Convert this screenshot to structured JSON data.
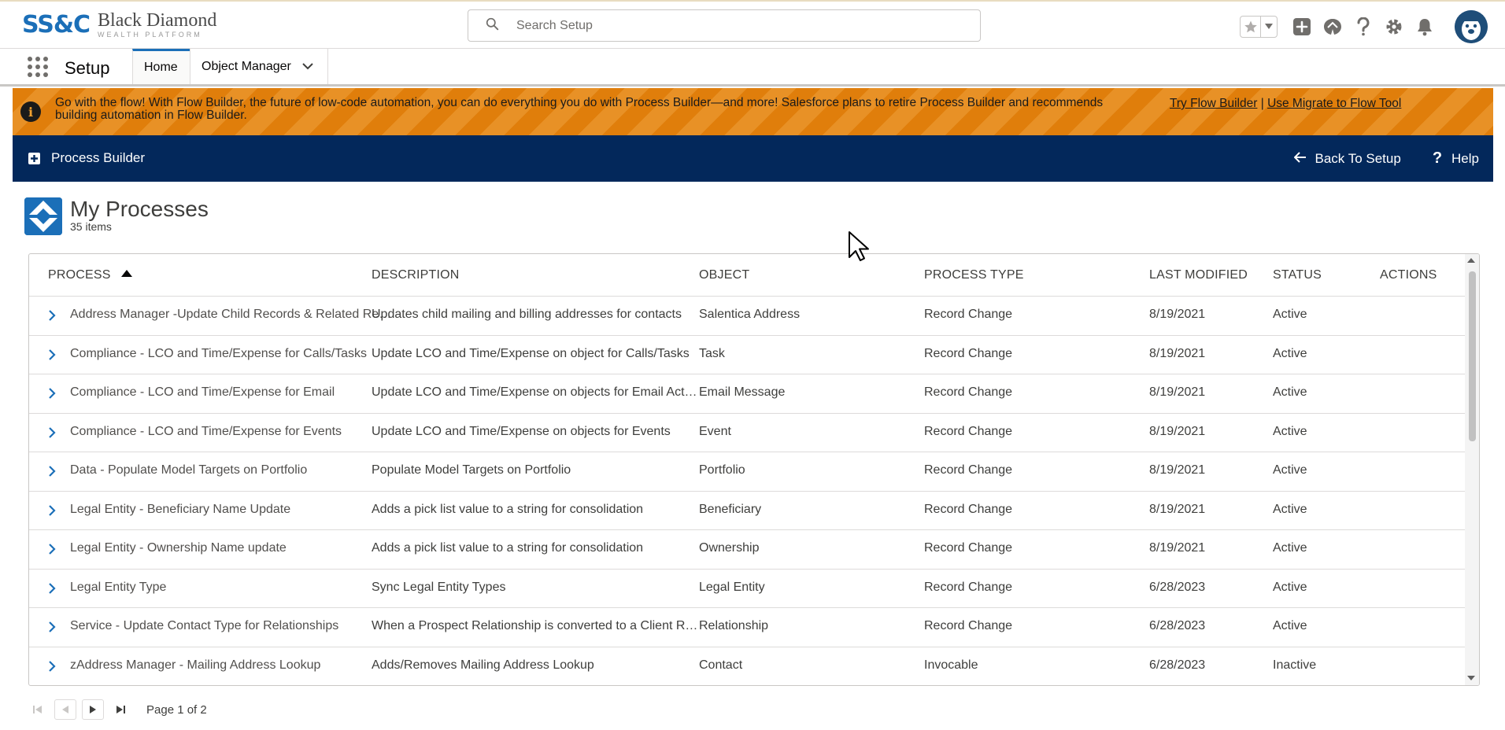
{
  "header": {
    "logo_mark": "SS&C",
    "logo_title": "Black Diamond",
    "logo_subtitle": "WEALTH PLATFORM",
    "search_placeholder": "Search Setup",
    "icons": [
      "star-icon",
      "chevron-down-icon",
      "add-icon",
      "trailhead-icon",
      "help-icon",
      "gear-icon",
      "bell-icon",
      "avatar"
    ]
  },
  "nav": {
    "app_name": "Setup",
    "tabs": [
      {
        "label": "Home",
        "active": true
      },
      {
        "label": "Object Manager",
        "active": false
      }
    ]
  },
  "banner": {
    "text": "Go with the flow! With Flow Builder, the future of low-code automation, you can do everything you do with Process Builder—and more! Salesforce plans to retire Process Builder and recommends building automation in Flow Builder.",
    "link_try": "Try Flow Builder",
    "separator": "|",
    "link_migrate": "Use Migrate to Flow Tool",
    "colors": {
      "stripe_a": "#e07e0b",
      "stripe_b": "#e89126"
    }
  },
  "pb_bar": {
    "title": "Process Builder",
    "back_label": "Back To Setup",
    "help_label": "Help",
    "color": "#03285b"
  },
  "processes": {
    "title": "My Processes",
    "count": "35 items",
    "columns": {
      "process": "PROCESS",
      "description": "DESCRIPTION",
      "object": "OBJECT",
      "type": "PROCESS TYPE",
      "modified": "LAST MODIFIED",
      "status": "STATUS",
      "actions": "ACTIONS"
    },
    "sort": {
      "column": "process",
      "direction": "ascending"
    },
    "rows": [
      {
        "process": "Address Manager -Update Child Records & Related Records",
        "description": "Updates child mailing and billing addresses for contacts",
        "object": "Salentica Address",
        "type": "Record Change",
        "modified": "8/19/2021",
        "status": "Active"
      },
      {
        "process": "Compliance - LCO and Time/Expense for Calls/Tasks",
        "description": "Update LCO and Time/Expense on object for Calls/Tasks",
        "object": "Task",
        "type": "Record Change",
        "modified": "8/19/2021",
        "status": "Active"
      },
      {
        "process": "Compliance - LCO and Time/Expense for Email",
        "description": "Update LCO and Time/Expense on objects for Email Activity",
        "object": "Email Message",
        "type": "Record Change",
        "modified": "8/19/2021",
        "status": "Active"
      },
      {
        "process": "Compliance - LCO and Time/Expense for Events",
        "description": "Update LCO and Time/Expense on objects for Events",
        "object": "Event",
        "type": "Record Change",
        "modified": "8/19/2021",
        "status": "Active"
      },
      {
        "process": "Data - Populate Model Targets on Portfolio",
        "description": "Populate Model Targets on Portfolio",
        "object": "Portfolio",
        "type": "Record Change",
        "modified": "8/19/2021",
        "status": "Active"
      },
      {
        "process": "Legal Entity - Beneficiary Name Update",
        "description": "Adds a pick list value to a string for consolidation",
        "object": "Beneficiary",
        "type": "Record Change",
        "modified": "8/19/2021",
        "status": "Active"
      },
      {
        "process": "Legal Entity - Ownership Name update",
        "description": "Adds a pick list value to a string for consolidation",
        "object": "Ownership",
        "type": "Record Change",
        "modified": "8/19/2021",
        "status": "Active"
      },
      {
        "process": "Legal Entity Type",
        "description": "Sync Legal Entity Types",
        "object": "Legal Entity",
        "type": "Record Change",
        "modified": "6/28/2023",
        "status": "Active"
      },
      {
        "process": "Service - Update Contact Type for Relationships",
        "description": "When a Prospect Relationship is converted to a Client Relationship",
        "object": "Relationship",
        "type": "Record Change",
        "modified": "6/28/2023",
        "status": "Active"
      },
      {
        "process": "zAddress Manager - Mailing Address Lookup",
        "description": "Adds/Removes Mailing Address Lookup",
        "object": "Contact",
        "type": "Invocable",
        "modified": "6/28/2023",
        "status": "Inactive"
      }
    ]
  },
  "pagination": {
    "label": "Page 1 of 2"
  }
}
